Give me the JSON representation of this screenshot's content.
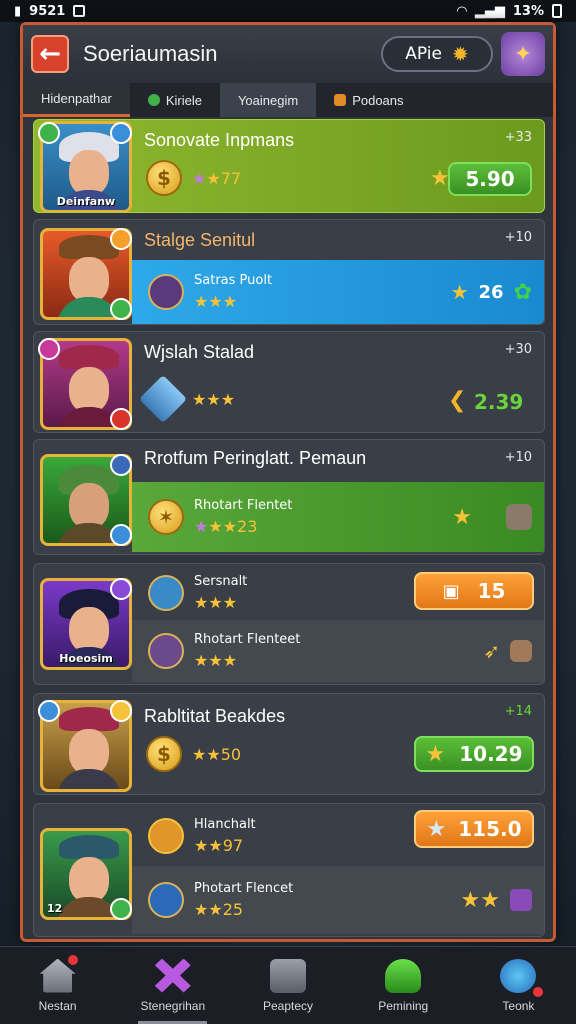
{
  "status": {
    "time": "9521",
    "battery": "13%"
  },
  "header": {
    "title": "Soeriaumasin",
    "apie_label": "APie"
  },
  "tabs": [
    {
      "label": "Hidenpathar"
    },
    {
      "label": "Kiriele"
    },
    {
      "label": "Yoainegim"
    },
    {
      "label": "Podoans"
    }
  ],
  "cards": [
    {
      "title": "Sonovate Inpmans",
      "portrait_label": "Deinfanw",
      "xp": "+33",
      "stars": "★77",
      "value": "5.90"
    },
    {
      "title": "Stalge Senitul",
      "xp": "+10",
      "sub_title": "Satras Puolt",
      "sub_value": "26"
    },
    {
      "title": "Wjslah Stalad",
      "xp": "+30",
      "value": "2.39"
    },
    {
      "title": "Rrotfum Peringlatt. Pemaun",
      "xp": "+10",
      "sub_title": "Rhotart Flentet",
      "sub_stars": "★★23"
    },
    {
      "sub_title_1": "Sersnalt",
      "portrait_label": "Hoeosim",
      "value": "15",
      "sub_title_2": "Rhotart Flenteet"
    },
    {
      "title": "Rabltitat Beakdes",
      "xp": "+14",
      "stars": "★★50",
      "value": "10.29"
    },
    {
      "sub_title_1": "Hlanchalt",
      "stars_1": "★★97",
      "value": "115.0",
      "sub_title_2": "Photart Flencet",
      "stars_2": "★★25",
      "portrait_label": "12"
    }
  ],
  "nav": [
    {
      "label": "Nestan"
    },
    {
      "label": "Stenegrihan"
    },
    {
      "label": "Peaptecy"
    },
    {
      "label": "Pemining"
    },
    {
      "label": "Teonk"
    }
  ]
}
